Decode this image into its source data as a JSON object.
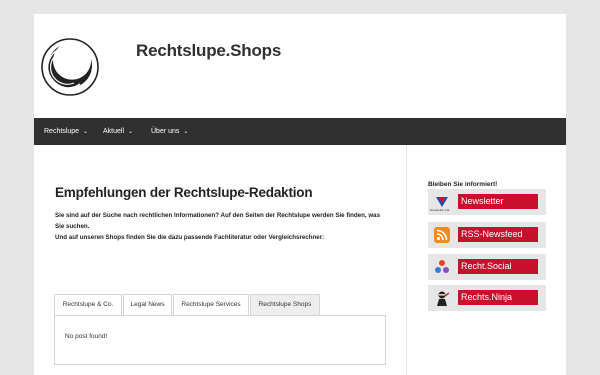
{
  "site": {
    "title": "Rechtslupe.Shops"
  },
  "nav": {
    "items": [
      {
        "label": "Rechtslupe"
      },
      {
        "label": "Aktuell"
      },
      {
        "label": "Über uns"
      }
    ]
  },
  "main": {
    "headline": "Empfehlungen der Rechtslupe-Redaktion",
    "intro_line1": "Sie sind auf der Suche nach rechtlichen Informationen? Auf den Seiten der Rechtslupe werden Sie finden, was Sie suchen.",
    "intro_line2": "Und auf unseren Shops finden Sie die dazu passende Fachliteratur oder Vergleichsrechner:",
    "tabs": [
      {
        "label": "Rechtslupe & Co."
      },
      {
        "label": "Legal News"
      },
      {
        "label": "Rechtslupe Services"
      },
      {
        "label": "Rechtslupe Shops"
      }
    ],
    "empty_message": "No post found!"
  },
  "sidebar": {
    "title": "Bleiben Sie informiert!",
    "banners": [
      {
        "label": "Newsletter",
        "small_text": "Newsletter Fat",
        "icon": "newsletter-icon",
        "color": "#c8102e"
      },
      {
        "label": "RSS-Newsfeed",
        "icon": "rss-icon",
        "color": "#c8102e"
      },
      {
        "label": "Recht.Social",
        "icon": "social-icon",
        "color": "#c8102e"
      },
      {
        "label": "Rechts.Ninja",
        "icon": "ninja-icon",
        "color": "#c8102e"
      }
    ]
  }
}
